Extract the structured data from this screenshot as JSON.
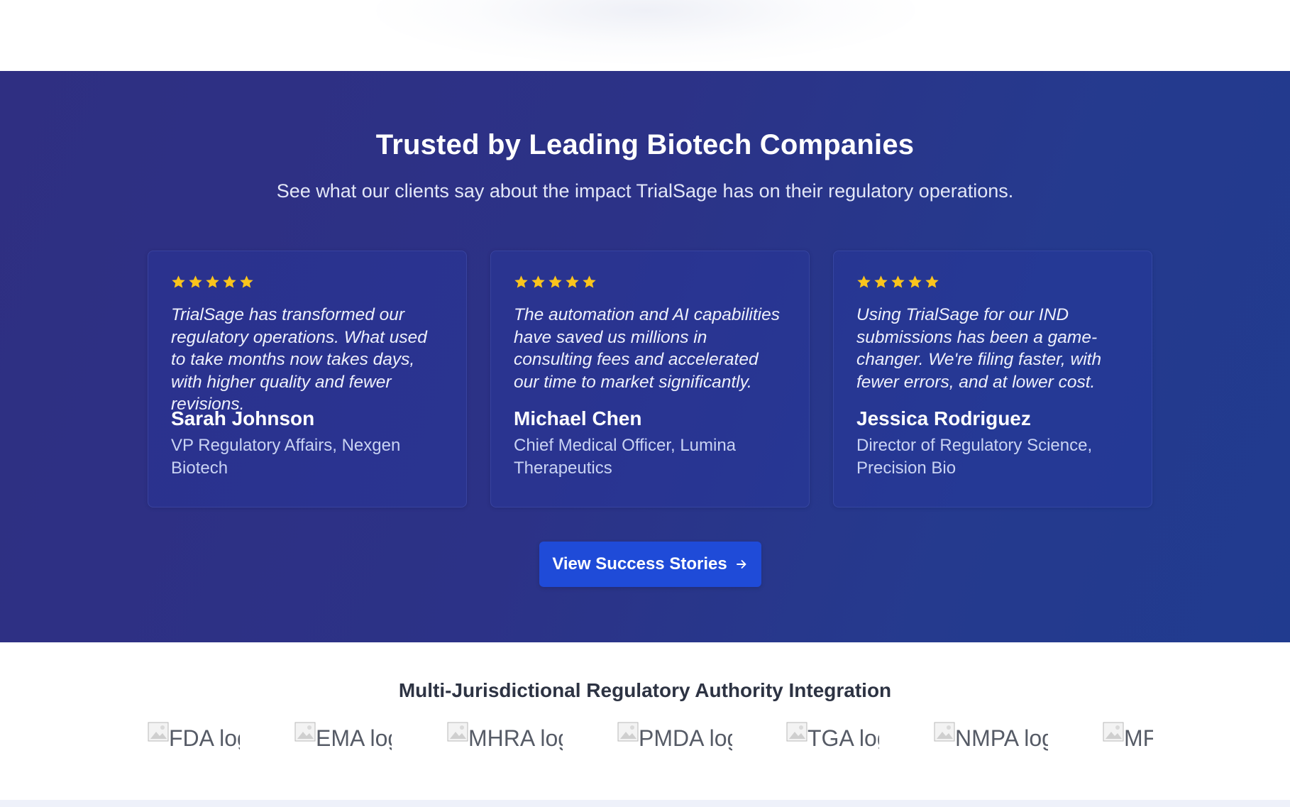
{
  "testimonials": {
    "title": "Trusted by Leading Biotech Companies",
    "subtitle": "See what our clients say about the impact TrialSage has on their regulatory operations.",
    "rating": 5,
    "cards": [
      {
        "quote": "TrialSage has transformed our regulatory operations. What used to take months now takes days, with higher quality and fewer revisions.",
        "name": "Sarah Johnson",
        "role": "VP Regulatory Affairs, Nexgen Biotech"
      },
      {
        "quote": "The automation and AI capabilities have saved us millions in consulting fees and accelerated our time to market significantly.",
        "name": "Michael Chen",
        "role": "Chief Medical Officer, Lumina Therapeutics"
      },
      {
        "quote": "Using TrialSage for our IND submissions has been a game-changer. We're filing faster, with fewer errors, and at lower cost.",
        "name": "Jessica Rodriguez",
        "role": "Director of Regulatory Science, Precision Bio"
      }
    ],
    "cta_label": "View Success Stories",
    "cta_icon": "arrow-right-icon"
  },
  "regulators": {
    "title": "Multi-Jurisdictional Regulatory Authority Integration",
    "logos": [
      {
        "alt": "FDA logo"
      },
      {
        "alt": "EMA logo"
      },
      {
        "alt": "MHRA logo"
      },
      {
        "alt": "PMDA logo"
      },
      {
        "alt": "TGA logo"
      },
      {
        "alt": "NMPA logo"
      },
      {
        "alt": "MFDS logo"
      }
    ]
  },
  "colors": {
    "star": "#fac41c",
    "cta_background": "#1f4bd8",
    "section_background_start": "#2f2f82",
    "section_background_end": "#213b8f"
  }
}
